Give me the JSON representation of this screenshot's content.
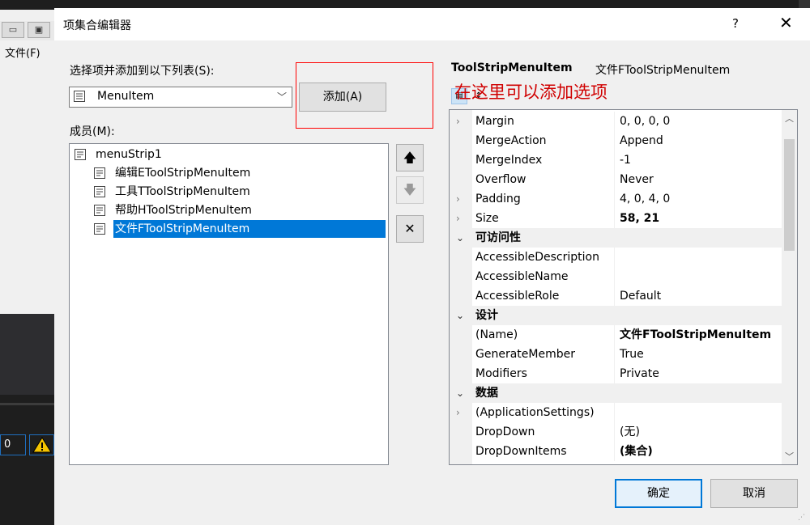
{
  "background": {
    "menu_label": "文件(F)",
    "error_count": "0"
  },
  "dialog": {
    "title": "项集合编辑器",
    "help_label": "?",
    "close_label": "✕"
  },
  "left": {
    "select_label": "选择项并添加到以下列表(S):",
    "combo_value": "MenuItem",
    "add_button": "添加(A)",
    "members_label": "成员(M):",
    "members": [
      {
        "label": "menuStrip1"
      },
      {
        "label": "编辑EToolStripMenuItem"
      },
      {
        "label": "工具TToolStripMenuItem"
      },
      {
        "label": "帮助HToolStripMenuItem"
      },
      {
        "label": "文件FToolStripMenuItem",
        "selected": true
      }
    ]
  },
  "properties": {
    "type_name": "ToolStripMenuItem",
    "object_name": "文件FToolStripMenuItem",
    "annotation": "在这里可以添加选项",
    "rows": [
      {
        "name": "Margin",
        "value": "0, 0, 0, 0",
        "expandable": true
      },
      {
        "name": "MergeAction",
        "value": "Append"
      },
      {
        "name": "MergeIndex",
        "value": "-1"
      },
      {
        "name": "Overflow",
        "value": "Never"
      },
      {
        "name": "Padding",
        "value": "4, 0, 4, 0",
        "expandable": true
      },
      {
        "name": "Size",
        "value": "58, 21",
        "expandable": true,
        "bold": true
      },
      {
        "name": "可访问性",
        "category": true
      },
      {
        "name": "AccessibleDescription",
        "value": ""
      },
      {
        "name": "AccessibleName",
        "value": ""
      },
      {
        "name": "AccessibleRole",
        "value": "Default"
      },
      {
        "name": "设计",
        "category": true
      },
      {
        "name": "(Name)",
        "value": "文件FToolStripMenuItem",
        "bold": true
      },
      {
        "name": "GenerateMember",
        "value": "True"
      },
      {
        "name": "Modifiers",
        "value": "Private"
      },
      {
        "name": "数据",
        "category": true
      },
      {
        "name": "(ApplicationSettings)",
        "value": "",
        "expandable": true
      },
      {
        "name": "DropDown",
        "value": "(无)"
      },
      {
        "name": "DropDownItems",
        "value": "(集合)",
        "bold": true
      }
    ]
  },
  "footer": {
    "ok": "确定",
    "cancel": "取消"
  },
  "colors": {
    "selection": "#0078d7",
    "annotation": "#d00000",
    "highlight_box": "#ff0000"
  }
}
